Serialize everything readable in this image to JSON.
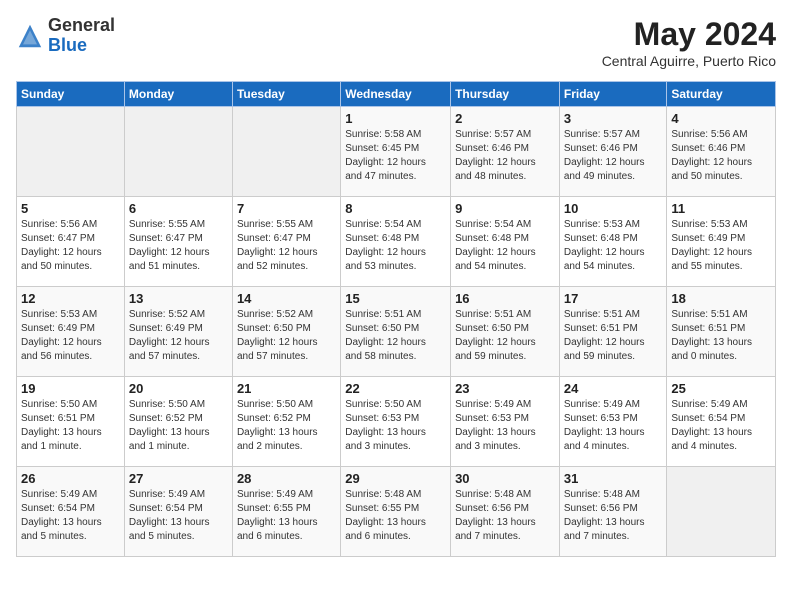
{
  "header": {
    "logo": {
      "general": "General",
      "blue": "Blue"
    },
    "title": "May 2024",
    "location": "Central Aguirre, Puerto Rico"
  },
  "days_of_week": [
    "Sunday",
    "Monday",
    "Tuesday",
    "Wednesday",
    "Thursday",
    "Friday",
    "Saturday"
  ],
  "weeks": [
    [
      {
        "day": "",
        "text": ""
      },
      {
        "day": "",
        "text": ""
      },
      {
        "day": "",
        "text": ""
      },
      {
        "day": "1",
        "text": "Sunrise: 5:58 AM\nSunset: 6:45 PM\nDaylight: 12 hours\nand 47 minutes."
      },
      {
        "day": "2",
        "text": "Sunrise: 5:57 AM\nSunset: 6:46 PM\nDaylight: 12 hours\nand 48 minutes."
      },
      {
        "day": "3",
        "text": "Sunrise: 5:57 AM\nSunset: 6:46 PM\nDaylight: 12 hours\nand 49 minutes."
      },
      {
        "day": "4",
        "text": "Sunrise: 5:56 AM\nSunset: 6:46 PM\nDaylight: 12 hours\nand 50 minutes."
      }
    ],
    [
      {
        "day": "5",
        "text": "Sunrise: 5:56 AM\nSunset: 6:47 PM\nDaylight: 12 hours\nand 50 minutes."
      },
      {
        "day": "6",
        "text": "Sunrise: 5:55 AM\nSunset: 6:47 PM\nDaylight: 12 hours\nand 51 minutes."
      },
      {
        "day": "7",
        "text": "Sunrise: 5:55 AM\nSunset: 6:47 PM\nDaylight: 12 hours\nand 52 minutes."
      },
      {
        "day": "8",
        "text": "Sunrise: 5:54 AM\nSunset: 6:48 PM\nDaylight: 12 hours\nand 53 minutes."
      },
      {
        "day": "9",
        "text": "Sunrise: 5:54 AM\nSunset: 6:48 PM\nDaylight: 12 hours\nand 54 minutes."
      },
      {
        "day": "10",
        "text": "Sunrise: 5:53 AM\nSunset: 6:48 PM\nDaylight: 12 hours\nand 54 minutes."
      },
      {
        "day": "11",
        "text": "Sunrise: 5:53 AM\nSunset: 6:49 PM\nDaylight: 12 hours\nand 55 minutes."
      }
    ],
    [
      {
        "day": "12",
        "text": "Sunrise: 5:53 AM\nSunset: 6:49 PM\nDaylight: 12 hours\nand 56 minutes."
      },
      {
        "day": "13",
        "text": "Sunrise: 5:52 AM\nSunset: 6:49 PM\nDaylight: 12 hours\nand 57 minutes."
      },
      {
        "day": "14",
        "text": "Sunrise: 5:52 AM\nSunset: 6:50 PM\nDaylight: 12 hours\nand 57 minutes."
      },
      {
        "day": "15",
        "text": "Sunrise: 5:51 AM\nSunset: 6:50 PM\nDaylight: 12 hours\nand 58 minutes."
      },
      {
        "day": "16",
        "text": "Sunrise: 5:51 AM\nSunset: 6:50 PM\nDaylight: 12 hours\nand 59 minutes."
      },
      {
        "day": "17",
        "text": "Sunrise: 5:51 AM\nSunset: 6:51 PM\nDaylight: 12 hours\nand 59 minutes."
      },
      {
        "day": "18",
        "text": "Sunrise: 5:51 AM\nSunset: 6:51 PM\nDaylight: 13 hours\nand 0 minutes."
      }
    ],
    [
      {
        "day": "19",
        "text": "Sunrise: 5:50 AM\nSunset: 6:51 PM\nDaylight: 13 hours\nand 1 minute."
      },
      {
        "day": "20",
        "text": "Sunrise: 5:50 AM\nSunset: 6:52 PM\nDaylight: 13 hours\nand 1 minute."
      },
      {
        "day": "21",
        "text": "Sunrise: 5:50 AM\nSunset: 6:52 PM\nDaylight: 13 hours\nand 2 minutes."
      },
      {
        "day": "22",
        "text": "Sunrise: 5:50 AM\nSunset: 6:53 PM\nDaylight: 13 hours\nand 3 minutes."
      },
      {
        "day": "23",
        "text": "Sunrise: 5:49 AM\nSunset: 6:53 PM\nDaylight: 13 hours\nand 3 minutes."
      },
      {
        "day": "24",
        "text": "Sunrise: 5:49 AM\nSunset: 6:53 PM\nDaylight: 13 hours\nand 4 minutes."
      },
      {
        "day": "25",
        "text": "Sunrise: 5:49 AM\nSunset: 6:54 PM\nDaylight: 13 hours\nand 4 minutes."
      }
    ],
    [
      {
        "day": "26",
        "text": "Sunrise: 5:49 AM\nSunset: 6:54 PM\nDaylight: 13 hours\nand 5 minutes."
      },
      {
        "day": "27",
        "text": "Sunrise: 5:49 AM\nSunset: 6:54 PM\nDaylight: 13 hours\nand 5 minutes."
      },
      {
        "day": "28",
        "text": "Sunrise: 5:49 AM\nSunset: 6:55 PM\nDaylight: 13 hours\nand 6 minutes."
      },
      {
        "day": "29",
        "text": "Sunrise: 5:48 AM\nSunset: 6:55 PM\nDaylight: 13 hours\nand 6 minutes."
      },
      {
        "day": "30",
        "text": "Sunrise: 5:48 AM\nSunset: 6:56 PM\nDaylight: 13 hours\nand 7 minutes."
      },
      {
        "day": "31",
        "text": "Sunrise: 5:48 AM\nSunset: 6:56 PM\nDaylight: 13 hours\nand 7 minutes."
      },
      {
        "day": "",
        "text": ""
      }
    ]
  ]
}
